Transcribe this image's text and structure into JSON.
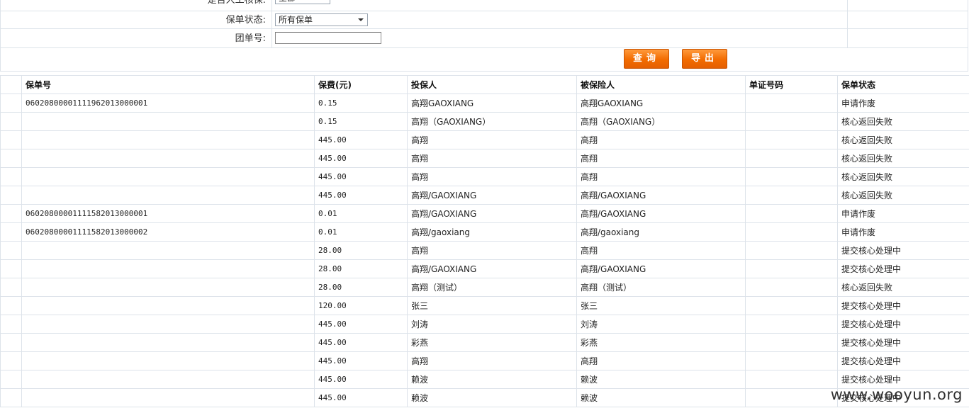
{
  "filters": {
    "manual_review": {
      "label": "是否人工核保:",
      "value": "全部"
    },
    "policy_status": {
      "label": "保单状态:",
      "value": "所有保单"
    },
    "group_no": {
      "label": "团单号:",
      "value": ""
    }
  },
  "buttons": {
    "query": "查询",
    "export": "导出"
  },
  "table": {
    "headers": [
      "",
      "保单号",
      "保费(元)",
      "投保人",
      "被保险人",
      "单证号码",
      "保单状态"
    ],
    "rows": [
      [
        "",
        "06020800001111962013000001",
        "0.15",
        "高翔GAOXIANG",
        "高翔GAOXIANG",
        "",
        "申请作废"
      ],
      [
        "",
        "",
        "0.15",
        "高翔（GAOXIANG）",
        "高翔（GAOXIANG）",
        "",
        "核心返回失败"
      ],
      [
        "",
        "",
        "445.00",
        "高翔",
        "高翔",
        "",
        "核心返回失败"
      ],
      [
        "",
        "",
        "445.00",
        "高翔",
        "高翔",
        "",
        "核心返回失败"
      ],
      [
        "",
        "",
        "445.00",
        "高翔",
        "高翔",
        "",
        "核心返回失败"
      ],
      [
        "",
        "",
        "445.00",
        "高翔/GAOXIANG",
        "高翔/GAOXIANG",
        "",
        "核心返回失败"
      ],
      [
        "",
        "06020800001111582013000001",
        "0.01",
        "高翔/GAOXIANG",
        "高翔/GAOXIANG",
        "",
        "申请作废"
      ],
      [
        "",
        "06020800001111582013000002",
        "0.01",
        "高翔/gaoxiang",
        "高翔/gaoxiang",
        "",
        "申请作废"
      ],
      [
        "",
        "",
        "28.00",
        "高翔",
        "高翔",
        "",
        "提交核心处理中"
      ],
      [
        "",
        "",
        "28.00",
        "高翔/GAOXIANG",
        "高翔/GAOXIANG",
        "",
        "提交核心处理中"
      ],
      [
        "",
        "",
        "28.00",
        "高翔（测试）",
        "高翔（测试）",
        "",
        "核心返回失败"
      ],
      [
        "",
        "",
        "120.00",
        "张三",
        "张三",
        "",
        "提交核心处理中"
      ],
      [
        "",
        "",
        "445.00",
        "刘涛",
        "刘涛",
        "",
        "提交核心处理中"
      ],
      [
        "",
        "",
        "445.00",
        "彩燕",
        "彩燕",
        "",
        "提交核心处理中"
      ],
      [
        "",
        "",
        "445.00",
        "高翔",
        "高翔",
        "",
        "提交核心处理中"
      ],
      [
        "",
        "",
        "445.00",
        "赖波",
        "赖波",
        "",
        "提交核心处理中"
      ],
      [
        "",
        "",
        "445.00",
        "赖波",
        "赖波",
        "",
        "提交核心处理中"
      ]
    ]
  },
  "watermark": "www.wooyun.org",
  "colors": {
    "button_orange": "#f26b00",
    "grid_line": "#dde3ea"
  }
}
